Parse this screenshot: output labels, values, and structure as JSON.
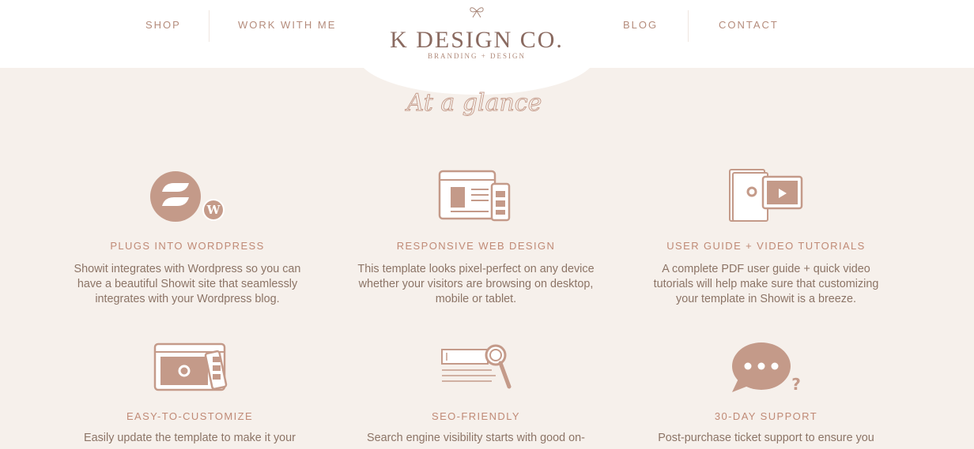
{
  "nav": {
    "left": [
      "SHOP",
      "WORK WITH ME"
    ],
    "right": [
      "BLOG",
      "CONTACT"
    ]
  },
  "logo": {
    "name": "K DESIGN CO.",
    "tagline": "BRANDING + DESIGN"
  },
  "heading": "At a glance",
  "features": [
    {
      "icon": "showit-wordpress-icon",
      "title": "PLUGS INTO WORDPRESS",
      "desc": "Showit integrates with Wordpress so you can have a beautiful Showit site that seamlessly integrates with your Wordpress blog."
    },
    {
      "icon": "responsive-devices-icon",
      "title": "RESPONSIVE WEB DESIGN",
      "desc": "This template looks pixel-perfect on any device whether your visitors are browsing on desktop, mobile or tablet."
    },
    {
      "icon": "guide-video-icon",
      "title": "USER GUIDE + VIDEO TUTORIALS",
      "desc": "A complete PDF user guide + quick video tutorials will help make sure that customizing your template in Showit is a breeze."
    },
    {
      "icon": "customize-palette-icon",
      "title": "EASY-TO-CUSTOMIZE",
      "desc": "Easily update the template to make it your"
    },
    {
      "icon": "seo-magnifier-icon",
      "title": "SEO-FRIENDLY",
      "desc": "Search engine visibility starts with good on-"
    },
    {
      "icon": "chat-support-icon",
      "title": "30-DAY SUPPORT",
      "desc": "Post-purchase ticket support to ensure you"
    }
  ],
  "colors": {
    "background": "#f6f0eb",
    "header": "#ffffff",
    "accent": "#c49a89",
    "text": "#8c7466"
  }
}
